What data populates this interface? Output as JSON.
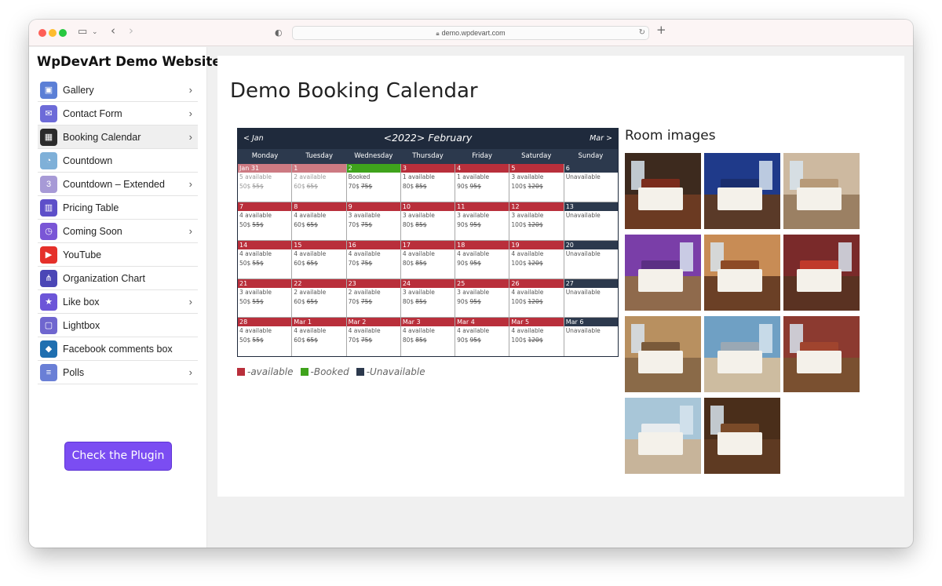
{
  "browser": {
    "url": "demo.wpdevart.com"
  },
  "site": {
    "title": "WpDevArt Demo Website"
  },
  "menu": [
    {
      "label": "Gallery",
      "icon": "gallery-icon",
      "color": "#5b7fd6",
      "glyph": "▣",
      "chevron": true
    },
    {
      "label": "Contact Form",
      "icon": "envelope-icon",
      "color": "#6d6bd8",
      "glyph": "✉",
      "chevron": true
    },
    {
      "label": "Booking Calendar",
      "icon": "calendar-icon",
      "color": "#2b2b2b",
      "glyph": "▦",
      "chevron": true,
      "active": true
    },
    {
      "label": "Countdown",
      "icon": "countdown-icon",
      "color": "#7fb0d8",
      "glyph": "◔",
      "chevron": false
    },
    {
      "label": "Countdown – Extended",
      "icon": "countdown-extended-icon",
      "color": "#a79ad6",
      "glyph": "3",
      "chevron": true
    },
    {
      "label": "Pricing Table",
      "icon": "pricing-table-icon",
      "color": "#5d4fc9",
      "glyph": "▥",
      "chevron": false
    },
    {
      "label": "Coming Soon",
      "icon": "clock-icon",
      "color": "#7a56d6",
      "glyph": "◷",
      "chevron": true
    },
    {
      "label": "YouTube",
      "icon": "youtube-icon",
      "color": "#e5302a",
      "glyph": "▶",
      "chevron": false
    },
    {
      "label": "Organization Chart",
      "icon": "org-chart-icon",
      "color": "#4b46b6",
      "glyph": "⋔",
      "chevron": false
    },
    {
      "label": "Like box",
      "icon": "thumbs-up-icon",
      "color": "#6c55d8",
      "glyph": "★",
      "chevron": true
    },
    {
      "label": "Lightbox",
      "icon": "lightbox-icon",
      "color": "#6f66cf",
      "glyph": "▢",
      "chevron": false
    },
    {
      "label": "Facebook comments box",
      "icon": "cube-icon",
      "color": "#1f6fb0",
      "glyph": "◆",
      "chevron": false
    },
    {
      "label": "Polls",
      "icon": "polls-icon",
      "color": "#6a7fd6",
      "glyph": "≡",
      "chevron": true
    }
  ],
  "plugin_button": "Check the Plugin",
  "page": {
    "title": "Demo Booking Calendar"
  },
  "colors": {
    "available": "#b92f3b",
    "booked": "#3fa31c",
    "unavailable": "#2c394d",
    "past": "#cd7a82"
  },
  "calendar": {
    "prev": "< Jan",
    "title": "<2022> February",
    "next": "Mar >",
    "weekdays": [
      "Monday",
      "Tuesday",
      "Wednesday",
      "Thursday",
      "Friday",
      "Saturday",
      "Sunday"
    ],
    "weeks": [
      [
        {
          "date": "Jan 31",
          "state": "past",
          "status": "5 available",
          "price": "50$",
          "old": "55$"
        },
        {
          "date": "1",
          "state": "past",
          "status": "2 available",
          "price": "60$",
          "old": "65$"
        },
        {
          "date": "2",
          "state": "booked",
          "status": "Booked",
          "price": "70$",
          "old": "75$"
        },
        {
          "date": "3",
          "state": "available",
          "status": "1 available",
          "price": "80$",
          "old": "85$"
        },
        {
          "date": "4",
          "state": "available",
          "status": "1 available",
          "price": "90$",
          "old": "95$"
        },
        {
          "date": "5",
          "state": "available",
          "status": "3 available",
          "price": "100$",
          "old": "120$"
        },
        {
          "date": "6",
          "state": "unavailable",
          "status": "Unavailable",
          "price": "",
          "old": ""
        }
      ],
      [
        {
          "date": "7",
          "state": "available",
          "status": "4 available",
          "price": "50$",
          "old": "55$"
        },
        {
          "date": "8",
          "state": "available",
          "status": "4 available",
          "price": "60$",
          "old": "65$"
        },
        {
          "date": "9",
          "state": "available",
          "status": "3 available",
          "price": "70$",
          "old": "75$"
        },
        {
          "date": "10",
          "state": "available",
          "status": "3 available",
          "price": "80$",
          "old": "85$"
        },
        {
          "date": "11",
          "state": "available",
          "status": "3 available",
          "price": "90$",
          "old": "95$"
        },
        {
          "date": "12",
          "state": "available",
          "status": "3 available",
          "price": "100$",
          "old": "120$"
        },
        {
          "date": "13",
          "state": "unavailable",
          "status": "Unavailable",
          "price": "",
          "old": ""
        }
      ],
      [
        {
          "date": "14",
          "state": "available",
          "status": "4 available",
          "price": "50$",
          "old": "55$"
        },
        {
          "date": "15",
          "state": "available",
          "status": "4 available",
          "price": "60$",
          "old": "65$"
        },
        {
          "date": "16",
          "state": "available",
          "status": "4 available",
          "price": "70$",
          "old": "75$"
        },
        {
          "date": "17",
          "state": "available",
          "status": "4 available",
          "price": "80$",
          "old": "85$"
        },
        {
          "date": "18",
          "state": "available",
          "status": "4 available",
          "price": "90$",
          "old": "95$"
        },
        {
          "date": "19",
          "state": "available",
          "status": "4 available",
          "price": "100$",
          "old": "120$"
        },
        {
          "date": "20",
          "state": "unavailable",
          "status": "Unavailable",
          "price": "",
          "old": ""
        }
      ],
      [
        {
          "date": "21",
          "state": "available",
          "status": "3 available",
          "price": "50$",
          "old": "55$"
        },
        {
          "date": "22",
          "state": "available",
          "status": "2 available",
          "price": "60$",
          "old": "65$"
        },
        {
          "date": "23",
          "state": "available",
          "status": "2 available",
          "price": "70$",
          "old": "75$"
        },
        {
          "date": "24",
          "state": "available",
          "status": "3 available",
          "price": "80$",
          "old": "85$"
        },
        {
          "date": "25",
          "state": "available",
          "status": "3 available",
          "price": "90$",
          "old": "95$"
        },
        {
          "date": "26",
          "state": "available",
          "status": "4 available",
          "price": "100$",
          "old": "120$"
        },
        {
          "date": "27",
          "state": "unavailable",
          "status": "Unavailable",
          "price": "",
          "old": ""
        }
      ],
      [
        {
          "date": "28",
          "state": "available",
          "status": "4 available",
          "price": "50$",
          "old": "55$"
        },
        {
          "date": "Mar 1",
          "state": "available",
          "status": "4 available",
          "price": "60$",
          "old": "65$"
        },
        {
          "date": "Mar 2",
          "state": "available",
          "status": "4 available",
          "price": "70$",
          "old": "75$"
        },
        {
          "date": "Mar 3",
          "state": "available",
          "status": "4 available",
          "price": "80$",
          "old": "85$"
        },
        {
          "date": "Mar 4",
          "state": "available",
          "status": "4 available",
          "price": "90$",
          "old": "95$"
        },
        {
          "date": "Mar 5",
          "state": "available",
          "status": "4 available",
          "price": "100$",
          "old": "120$"
        },
        {
          "date": "Mar 6",
          "state": "unavailable",
          "status": "Unavailable",
          "price": "",
          "old": ""
        }
      ]
    ]
  },
  "legend": [
    {
      "label": "-available",
      "color": "#b92f3b"
    },
    {
      "label": "-Booked",
      "color": "#3fa31c"
    },
    {
      "label": "-Unavailable",
      "color": "#2c394d"
    }
  ],
  "rooms": {
    "title": "Room images",
    "images": [
      {
        "wall": "#3d2a1e",
        "floor": "#6b3a22",
        "head": "#7a2c1c"
      },
      {
        "wall": "#1f3a8a",
        "floor": "#5a3a28",
        "head": "#1a2e6e"
      },
      {
        "wall": "#cdb9a0",
        "floor": "#9b8063",
        "head": "#b79a78"
      },
      {
        "wall": "#7a3ea8",
        "floor": "#8f6a4c",
        "head": "#5b2f84"
      },
      {
        "wall": "#c88c55",
        "floor": "#6b4026",
        "head": "#8d4a26"
      },
      {
        "wall": "#7a2a2a",
        "floor": "#5a3222",
        "head": "#c0392b"
      },
      {
        "wall": "#b89060",
        "floor": "#8a6a48",
        "head": "#7a5a3a"
      },
      {
        "wall": "#6fa0c4",
        "floor": "#cdbca0",
        "head": "#9aa8b4"
      },
      {
        "wall": "#8c3a30",
        "floor": "#7a5030",
        "head": "#a0442e"
      },
      {
        "wall": "#a8c6d8",
        "floor": "#c7b49a",
        "head": "#e8ecef"
      },
      {
        "wall": "#4a2e1a",
        "floor": "#5e3a22",
        "head": "#7a4a28"
      }
    ]
  }
}
